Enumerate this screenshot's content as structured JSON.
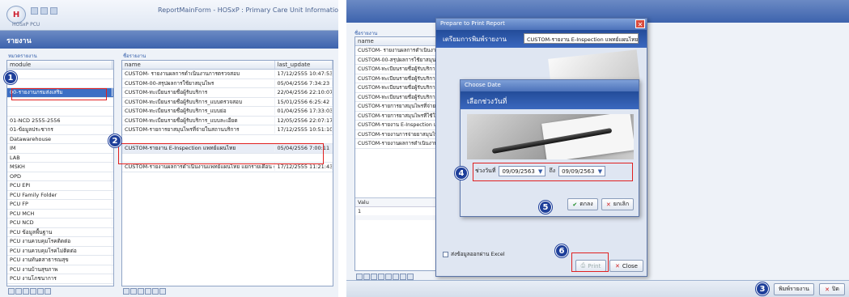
{
  "left": {
    "app_title": "ReportMainForm - HOSxP : Primary Care Unit Information Sys",
    "app_subtitle": "HOSxP PCU",
    "ribbon_title": "รายงาน",
    "pane_left_header": "หมวดรายงาน",
    "pane_right_header": "ชื่อรายงาน",
    "module_col": "module",
    "modules": [
      "",
      "",
      "00-รายงานกรมส่งเสริม",
      "",
      "",
      "01-NCD 2555-2556",
      "01-ข้อมูลประชากร",
      "Datawarehouse",
      "IM",
      "LAB",
      "MSKH",
      "OPD",
      "PCU EPI",
      "PCU Family Folder",
      "PCU FP",
      "PCU MCH",
      "PCU NCD",
      "PCU ข้อมูลพื้นฐาน",
      "PCU งานควบคุมโรคติดต่อ",
      "PCU งานควบคุมโรคไม่ติดต่อ",
      "PCU งานทันตสาธารณสุข",
      "PCU งานบ้านสุขภาพ",
      "PCU งานโภชนาการ"
    ],
    "report_cols": [
      "name",
      "last_update"
    ],
    "reports": [
      [
        "CUSTOM- รายงานผลการดำเนินงานการตรวจสอบ",
        "17/12/2555 10:47:53"
      ],
      [
        "CUSTOM-00-สรุปผลการใช้ยาสมุนไพร",
        "05/04/2556 7:34:23"
      ],
      [
        "CUSTOM-ทะเบียนรายชื่อผู้รับบริการ",
        "22/04/2556 22:10:07"
      ],
      [
        "CUSTOM-ทะเบียนรายชื่อผู้รับบริการ_แบบตรวจสอบ",
        "15/01/2556 6:25:42"
      ],
      [
        "CUSTOM-ทะเบียนรายชื่อผู้รับบริการ_แบบย่อ",
        "01/04/2556 17:33:03"
      ],
      [
        "CUSTOM-ทะเบียนรายชื่อผู้รับบริการ_แบบละเอียด",
        "12/05/2556 22:07:17"
      ],
      [
        "CUSTOM-รายการยาสมุนไพรที่จ่ายในสถานบริการ",
        "17/12/2555 10:51:10"
      ],
      [
        "",
        ""
      ],
      [
        "CUSTOM-รายงาน E-Inspection แพทย์แผนไทย",
        "05/04/2556 7:00:11"
      ],
      [
        "",
        ""
      ],
      [
        "CUSTOM-รายงานผลการดำเนินงานแพทย์แผนไทย แยกรายเดือน ตามปีงบ",
        "17/12/2555 11:21:43"
      ]
    ]
  },
  "right": {
    "pane_header": "ชื่อรายงาน",
    "name_col": "name",
    "names": [
      "CUSTOM- รายงานผลการดำเนินงาน",
      "CUSTOM-00-สรุปผลการใช้ยาสมุนไพ",
      "CUSTOM-ทะเบียนรายชื่อผู้รับบริการ",
      "CUSTOM-ทะเบียนรายชื่อผู้รับบริการ",
      "CUSTOM-ทะเบียนรายชื่อผู้รับบริการ",
      "CUSTOM-ทะเบียนรายชื่อผู้รับบริการ",
      "CUSTOM-รายการยาสมุนไพรที่จ่ายใน",
      "CUSTOM-รายการยาสมุนไพรที่ใช้ใน",
      "CUSTOM-รายงาน E-Inspection แพ",
      "CUSTOM-รายงานการจ่ายยาสมุนไพร (",
      "CUSTOM-รายงานผลการดำเนินงานแพ"
    ],
    "value_label": "Valu",
    "value_cell": "1",
    "print_dialog": {
      "title": "Prepare to Print Report",
      "heading": "เตรียมการพิมพ์รายงาน",
      "report_name": "CUSTOM-รายงาน E-Inspection แพทย์แผนไทย",
      "excel_label": "ส่งข้อมูลออกผ่าน Excel",
      "print_btn": "Print",
      "close_btn": "Close"
    },
    "date_dialog": {
      "title": "Choose Date",
      "heading": "เลือกช่วงวันที่",
      "range_label": "ช่วงวันที่",
      "to_label": "ถึง",
      "from_date": "09/09/2563",
      "to_date": "09/09/2563",
      "ok_btn": "ตกลง",
      "cancel_btn": "ยกเลิก"
    },
    "bottom_print_btn": "พิมพ์รายงาน",
    "bottom_close_btn": "ปิด"
  },
  "steps": [
    "1",
    "2",
    "3",
    "4",
    "5",
    "6"
  ]
}
